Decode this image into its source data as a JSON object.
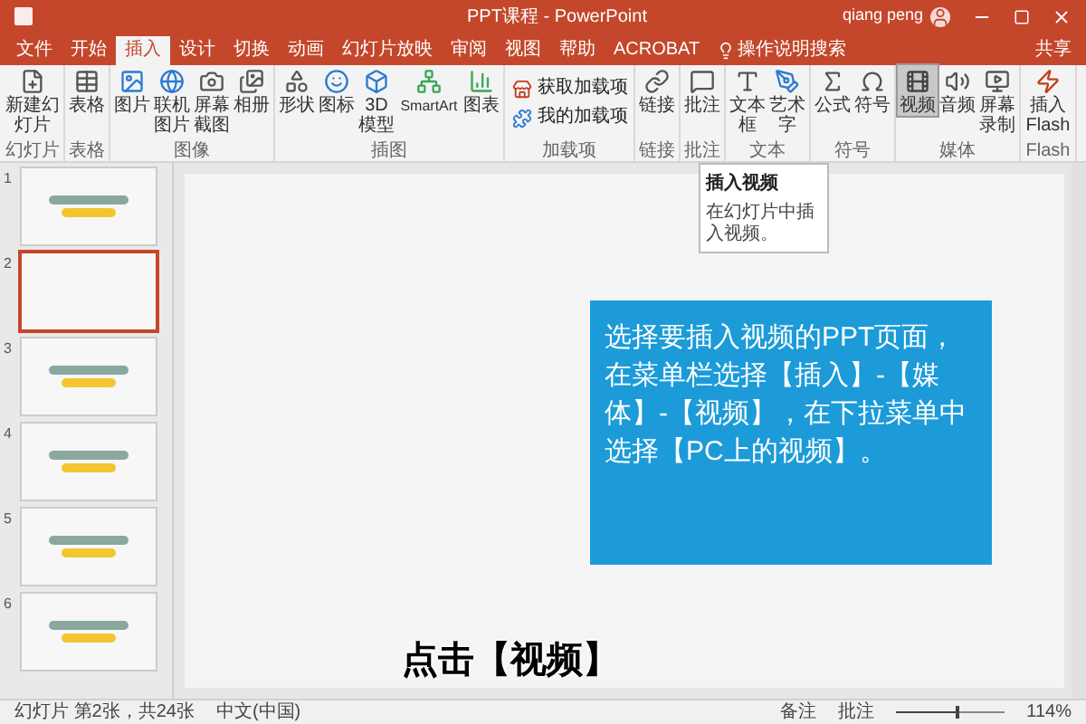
{
  "window": {
    "title": "PPT课程 - PowerPoint",
    "user": "qiang peng",
    "share": "共享"
  },
  "tabs": [
    {
      "label": "文件",
      "selected": false
    },
    {
      "label": "开始",
      "selected": false
    },
    {
      "label": "插入",
      "selected": true
    },
    {
      "label": "设计",
      "selected": false
    },
    {
      "label": "切换",
      "selected": false
    },
    {
      "label": "动画",
      "selected": false
    },
    {
      "label": "幻灯片放映",
      "selected": false
    },
    {
      "label": "审阅",
      "selected": false
    },
    {
      "label": "视图",
      "selected": false
    },
    {
      "label": "帮助",
      "selected": false
    },
    {
      "label": "ACROBAT",
      "selected": false
    }
  ],
  "tell_me": "操作说明搜索",
  "ribbon": [
    {
      "label": "幻灯片",
      "buttons": [
        {
          "label": "新建幻灯片",
          "kind": "new-slide",
          "selected": false
        }
      ]
    },
    {
      "label": "表格",
      "buttons": [
        {
          "label": "表格",
          "kind": "table",
          "selected": false
        }
      ]
    },
    {
      "label": "图像",
      "buttons": [
        {
          "label": "图片",
          "kind": "picture",
          "selected": false
        },
        {
          "label": "联机图片",
          "kind": "online",
          "selected": false
        },
        {
          "label": "屏幕截图",
          "kind": "screenshot",
          "selected": false
        },
        {
          "label": "相册",
          "kind": "album",
          "selected": false
        }
      ]
    },
    {
      "label": "插图",
      "buttons": [
        {
          "label": "形状",
          "kind": "shape",
          "selected": false
        },
        {
          "label": "图标",
          "kind": "icons",
          "selected": false
        },
        {
          "label": "3D模型",
          "kind": "cube",
          "selected": false
        },
        {
          "label": "SmartArt",
          "kind": "smartart",
          "selected": false
        },
        {
          "label": "图表",
          "kind": "chart",
          "selected": false
        }
      ]
    },
    {
      "label": "加载项",
      "buttons": [
        {
          "label": "获取加载项",
          "kind": "store",
          "selected": false
        },
        {
          "label": "我的加载项",
          "kind": "addin",
          "selected": false
        }
      ]
    },
    {
      "label": "链接",
      "buttons": [
        {
          "label": "链接",
          "kind": "link",
          "selected": false
        }
      ]
    },
    {
      "label": "批注",
      "buttons": [
        {
          "label": "批注",
          "kind": "comment",
          "selected": false
        }
      ]
    },
    {
      "label": "文本",
      "buttons": [
        {
          "label": "文本框",
          "kind": "textbox",
          "selected": false
        },
        {
          "label": "艺术字",
          "kind": "wordart",
          "selected": false
        }
      ]
    },
    {
      "label": "符号",
      "buttons": [
        {
          "label": "公式",
          "kind": "equation",
          "selected": false
        },
        {
          "label": "符号",
          "kind": "symbol",
          "selected": false
        }
      ]
    },
    {
      "label": "媒体",
      "buttons": [
        {
          "label": "视频",
          "kind": "video",
          "selected": true
        },
        {
          "label": "音频",
          "kind": "audio",
          "selected": false
        },
        {
          "label": "屏幕录制",
          "kind": "record",
          "selected": false
        }
      ]
    },
    {
      "label": "Flash",
      "buttons": [
        {
          "label": "插入Flash",
          "kind": "flash",
          "selected": false
        }
      ]
    }
  ],
  "tooltip": {
    "title": "插入视频",
    "body": "在幻灯片中插入视频。"
  },
  "thumbnails": [
    {
      "number": "1",
      "selected": false
    },
    {
      "number": "2",
      "selected": true
    },
    {
      "number": "3",
      "selected": false
    },
    {
      "number": "4",
      "selected": false
    },
    {
      "number": "5",
      "selected": false
    },
    {
      "number": "6",
      "selected": false
    }
  ],
  "slide": {
    "callout": "选择要插入视频的PPT页面，在菜单栏选择【插入】-【媒体】-【视频】，在下拉菜单中选择【PC上的视频】。",
    "caption": "点击【视频】"
  },
  "status_bar": {
    "slide": "幻灯片 第2张，共24张",
    "language": "中文(中国)",
    "notes": "备注",
    "comments": "批注",
    "zoom": "114%",
    "zoom_level": {
      "level": 0.55
    }
  }
}
